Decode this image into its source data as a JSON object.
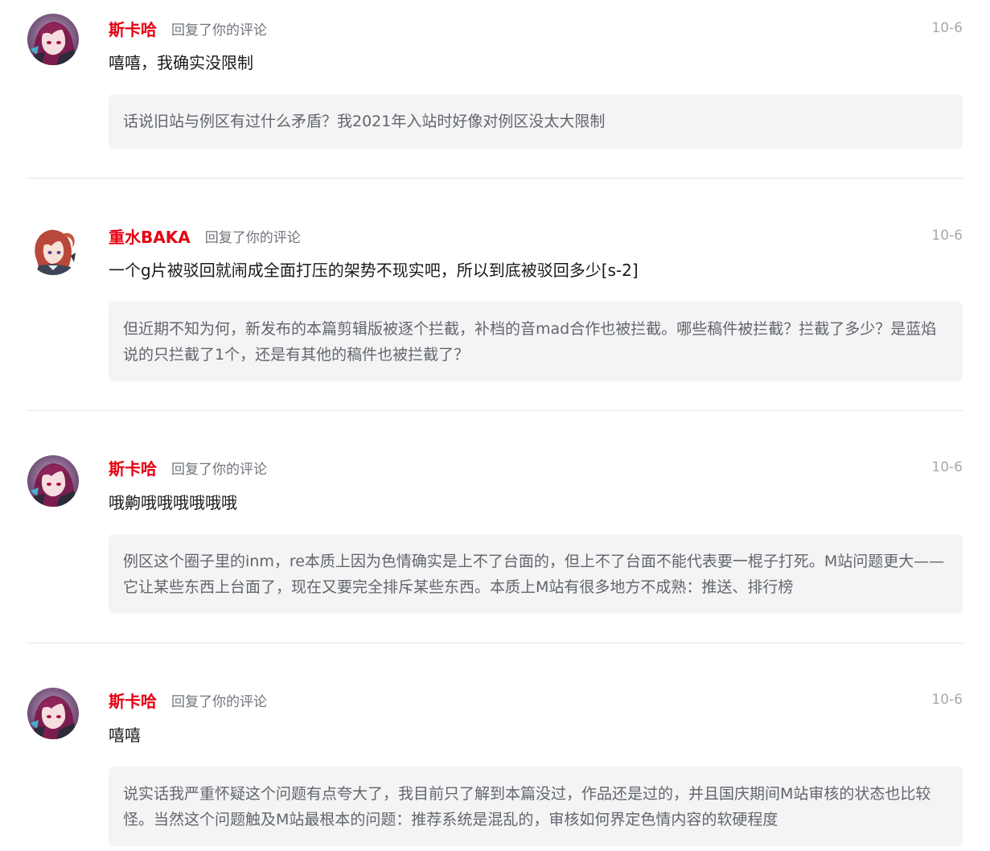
{
  "notifications": [
    {
      "user": "斯卡哈",
      "action": "回复了你的评论",
      "time": "10-6",
      "reply": "嘻嘻，我确实没限制",
      "quote": "话说旧站与例区有过什么矛盾？我2021年入站时好像对例区没太大限制",
      "avatar": "avatar-purple-hair"
    },
    {
      "user": "重水BAKA",
      "action": "回复了你的评论",
      "time": "10-6",
      "reply": "一个g片被驳回就闹成全面打压的架势不现实吧，所以到底被驳回多少[s-2]",
      "quote": "但近期不知为何，新发布的本篇剪辑版被逐个拦截，补档的音mad合作也被拦截。哪些稿件被拦截？拦截了多少？是蓝焰说的只拦截了1个，还是有其他的稿件也被拦截了？",
      "avatar": "avatar-red-hair"
    },
    {
      "user": "斯卡哈",
      "action": "回复了你的评论",
      "time": "10-6",
      "reply": "哦齁哦哦哦哦哦哦",
      "quote": "例区这个圈子里的inm，re本质上因为色情确实是上不了台面的，但上不了台面不能代表要一棍子打死。M站问题更大——它让某些东西上台面了，现在又要完全排斥某些东西。本质上M站有很多地方不成熟：推送、排行榜",
      "avatar": "avatar-purple-hair"
    },
    {
      "user": "斯卡哈",
      "action": "回复了你的评论",
      "time": "10-6",
      "reply": "嘻嘻",
      "quote": "说实话我严重怀疑这个问题有点夸大了，我目前只了解到本篇没过，作品还是过的，并且国庆期间M站审核的状态也比较怪。当然这个问题触及M站最根本的问题：推荐系统是混乱的，审核如何界定色情内容的软硬程度",
      "avatar": "avatar-purple-hair"
    }
  ],
  "colors": {
    "username": "#e60012",
    "action": "#6f747b",
    "time": "#a5a9ae",
    "reply": "#18191c",
    "quote_bg": "#f4f4f5",
    "quote_text": "#61666d",
    "divider": "#e7e7e7"
  }
}
